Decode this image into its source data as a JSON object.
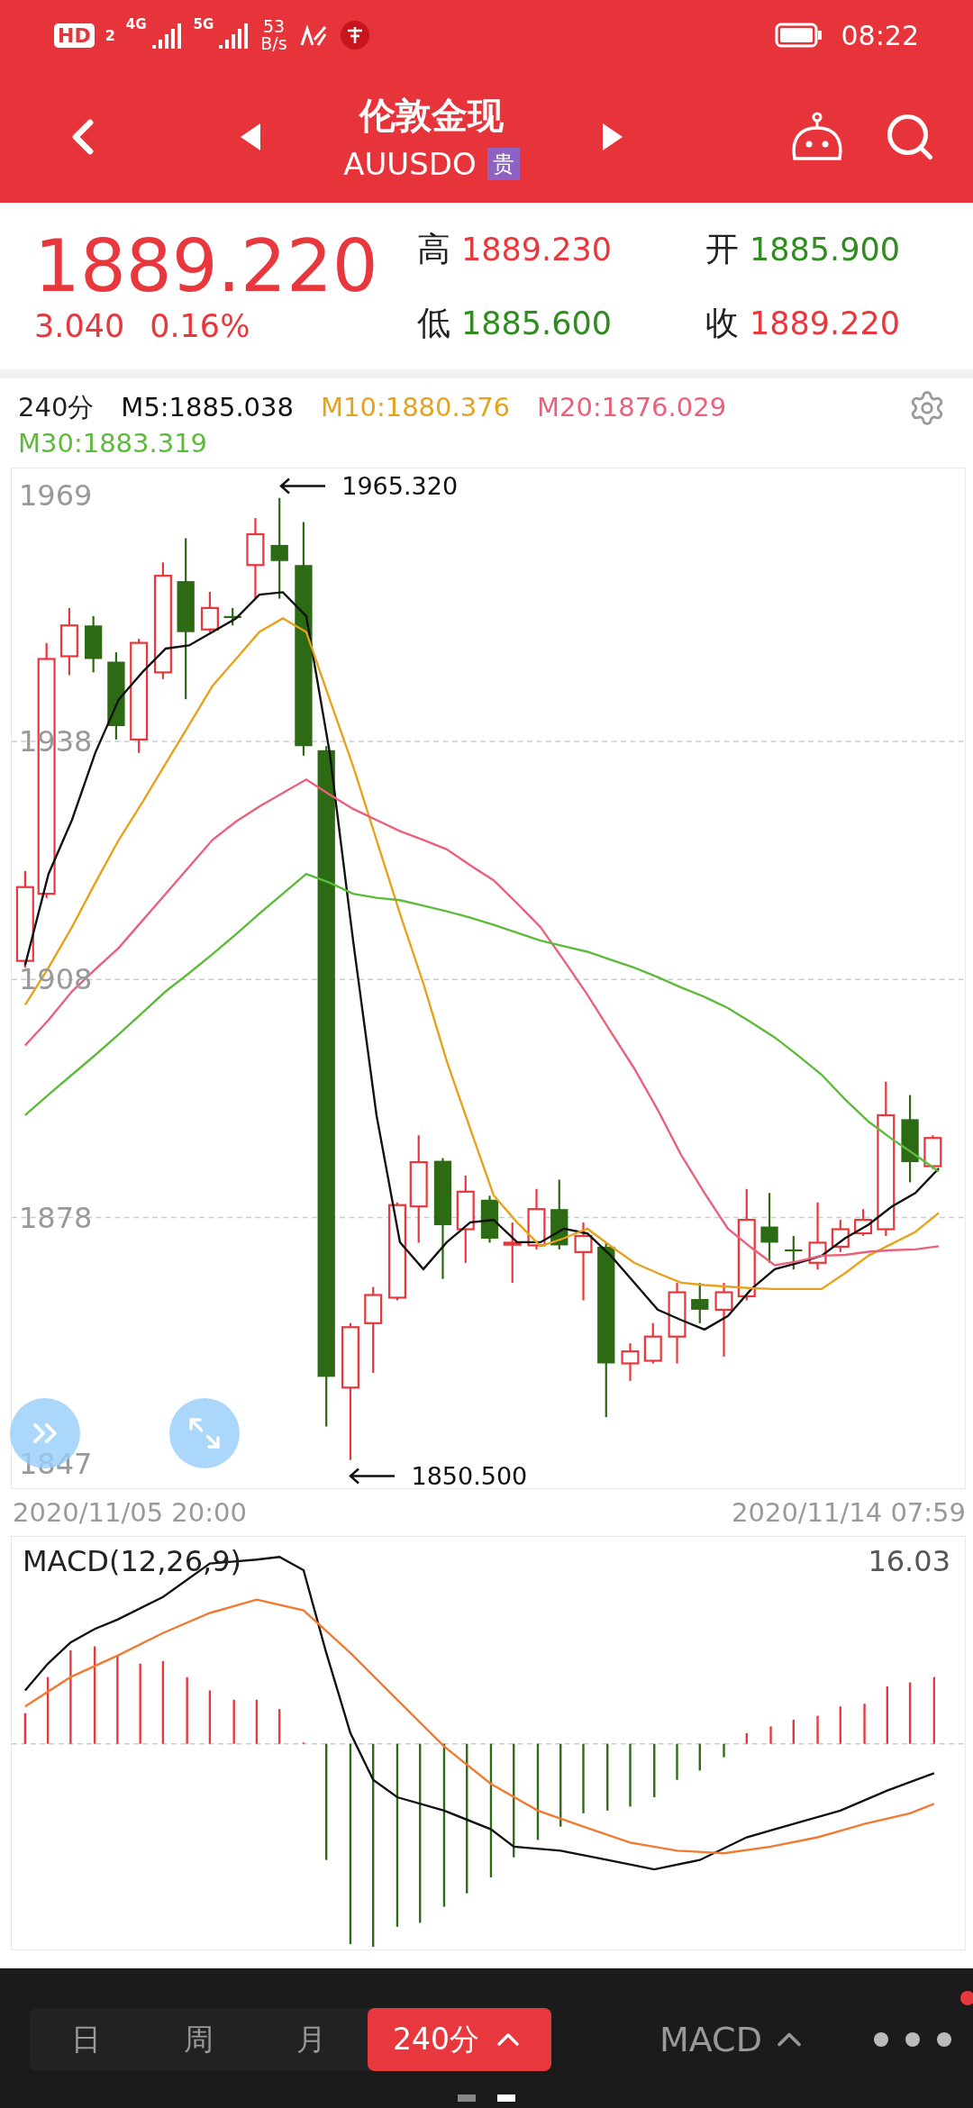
{
  "status_bar": {
    "hd": "HD",
    "sim": "2",
    "network_1": "4G",
    "network_2": "5G",
    "speed_value": "53",
    "speed_unit": "B/s",
    "time": "08:22"
  },
  "header": {
    "title": "伦敦金现",
    "code": "AUUSDO",
    "tag": "贵"
  },
  "quote": {
    "price": "1889.220",
    "change": "3.040",
    "change_percent": "0.16%",
    "stats": [
      {
        "label": "高",
        "value": "1889.230",
        "color": "#e8383d"
      },
      {
        "label": "开",
        "value": "1885.900",
        "color": "#2f8c1f"
      },
      {
        "label": "低",
        "value": "1885.600",
        "color": "#2f8c1f"
      },
      {
        "label": "收",
        "value": "1889.220",
        "color": "#e8383d"
      }
    ]
  },
  "chart": {
    "period": "240分",
    "chart_data": {
      "type": "line",
      "grid": true,
      "ylim": [
        1843.9,
        1972.4
      ],
      "yticks": [
        1969,
        1938,
        1908,
        1878,
        1847
      ],
      "series": [
        {
          "name": "M5:1885.038",
          "color": "#111111",
          "values": [
            1909.8,
            1921.3,
            1928.1,
            1936.6,
            1943.3,
            1946.7,
            1949.7,
            1950.1,
            1951.8,
            1953.5,
            1956.5,
            1956.8,
            1953.8,
            1936.6,
            1912.9,
            1890.9,
            1874.9,
            1871.5,
            1874.9,
            1877.4,
            1877.7,
            1874.9,
            1874.9,
            1876.6,
            1876.0,
            1873.2,
            1869.8,
            1866.4,
            1865.1,
            1863.9,
            1865.6,
            1869.0,
            1871.5,
            1872.3,
            1873.2,
            1875.4,
            1877.1,
            1879.4,
            1881.1,
            1884.2
          ]
        },
        {
          "name": "M10:1880.376",
          "color": "#e6a21a",
          "values": [
            1904.8,
            1909.5,
            1914.6,
            1920.2,
            1925.6,
            1930.3,
            1935.2,
            1940.1,
            1945.0,
            1948.4,
            1951.8,
            1953.5,
            1951.8,
            1943.3,
            1934.9,
            1925.6,
            1916.3,
            1907.5,
            1897.7,
            1889.2,
            1880.8,
            1877.4,
            1874.4,
            1875.4,
            1876.6,
            1874.4,
            1872.3,
            1871.0,
            1869.8,
            1869.5,
            1869.3,
            1869.1,
            1869.0,
            1869.0,
            1869.0,
            1871.0,
            1873.2,
            1874.7,
            1876.2,
            1878.6
          ]
        },
        {
          "name": "M20:1876.029",
          "color": "#ec5f7a",
          "values": [
            1899.7,
            1902.9,
            1906.5,
            1909.3,
            1912.0,
            1915.4,
            1918.8,
            1922.2,
            1925.6,
            1927.9,
            1929.8,
            1931.5,
            1933.2,
            1931.3,
            1929.5,
            1928.1,
            1926.7,
            1925.6,
            1924.4,
            1922.4,
            1920.5,
            1917.6,
            1914.6,
            1910.4,
            1906.1,
            1901.4,
            1896.8,
            1891.6,
            1885.9,
            1881.1,
            1876.6,
            1874.2,
            1872.0,
            1872.5,
            1873.2,
            1873.3,
            1873.7,
            1873.9,
            1874.0,
            1874.4
          ]
        },
        {
          "name": "M30:1883.319",
          "color": "#5dbb3b",
          "values": [
            1890.9,
            1893.5,
            1896.0,
            1898.5,
            1901.1,
            1903.8,
            1906.5,
            1908.8,
            1911.2,
            1913.7,
            1916.3,
            1918.8,
            1921.3,
            1920.2,
            1918.8,
            1918.3,
            1918.0,
            1917.3,
            1916.6,
            1915.8,
            1914.9,
            1913.9,
            1912.9,
            1912.2,
            1911.5,
            1910.5,
            1909.5,
            1908.3,
            1907.0,
            1905.8,
            1904.4,
            1902.6,
            1900.7,
            1898.4,
            1896.0,
            1892.9,
            1890.1,
            1887.9,
            1885.9,
            1883.8
          ]
        }
      ],
      "annotations": [
        "1965.320",
        "1850.500"
      ]
    },
    "start_time": "2020/11/05 20:00",
    "end_time": "2020/11/14 07:59"
  },
  "indicator": {
    "title": "MACD(12,26,9)",
    "value": "16.03"
  },
  "bottom_bar": {
    "periods": [
      {
        "label": "日",
        "selected": false
      },
      {
        "label": "周",
        "selected": false
      },
      {
        "label": "月",
        "selected": false
      },
      {
        "label": "240分",
        "selected": true
      }
    ],
    "indicator": "MACD",
    "notification": true
  }
}
